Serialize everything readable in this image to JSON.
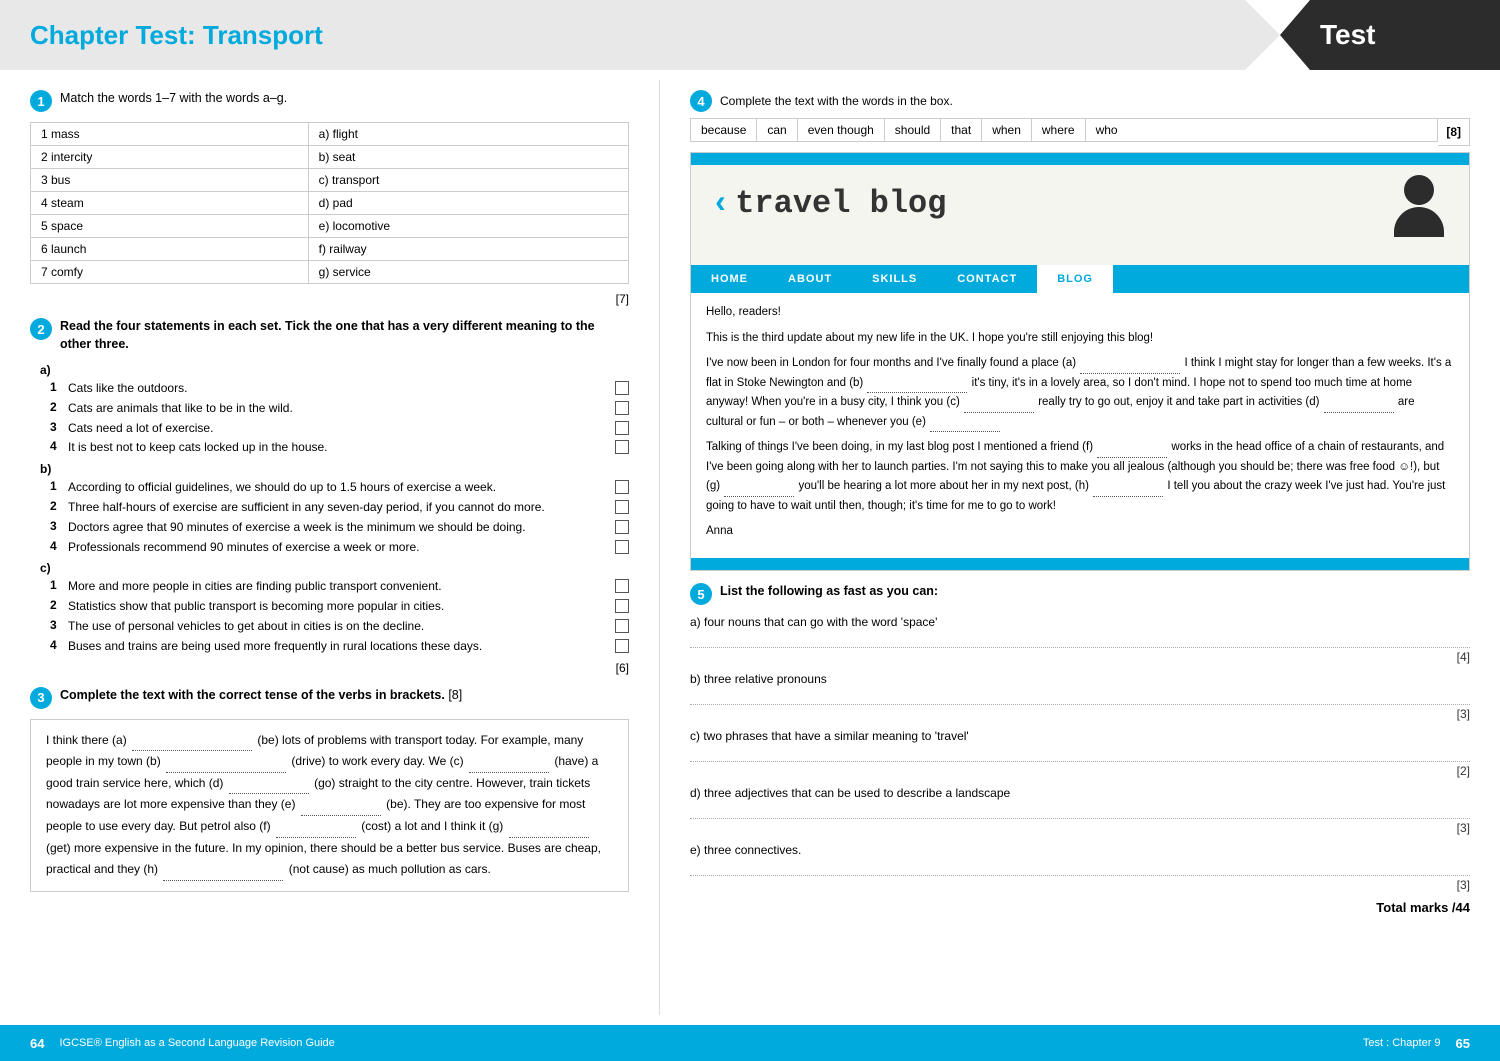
{
  "header": {
    "title": "Chapter Test: Transport",
    "right_label": "Test"
  },
  "q1": {
    "instruction": "Match the words 1–7 with the words a–g.",
    "marks": "[7]",
    "rows": [
      {
        "num": "1",
        "left": "mass",
        "right": "a)  flight"
      },
      {
        "num": "2",
        "left": "intercity",
        "right": "b)  seat"
      },
      {
        "num": "3",
        "left": "bus",
        "right": "c)  transport"
      },
      {
        "num": "4",
        "left": "steam",
        "right": "d)  pad"
      },
      {
        "num": "5",
        "left": "space",
        "right": "e)  locomotive"
      },
      {
        "num": "6",
        "left": "launch",
        "right": "f)  railway"
      },
      {
        "num": "7",
        "left": "comfy",
        "right": "g)  service"
      }
    ]
  },
  "q2": {
    "instruction": "Read the four statements in each set. Tick the one that has a very different meaning to the other three.",
    "groups": [
      {
        "label": "a)",
        "items": [
          "Cats like the outdoors.",
          "Cats are animals that like to be in the wild.",
          "Cats need a lot of exercise.",
          "It is best not to keep cats locked up in the house."
        ]
      },
      {
        "label": "b)",
        "items": [
          "According to official guidelines, we should do up to 1.5 hours of exercise a week.",
          "Three half-hours of exercise are sufficient in any seven-day period, if you cannot do more.",
          "Doctors agree that 90 minutes of exercise a week is the minimum we should be doing.",
          "Professionals recommend 90 minutes of exercise a week or more."
        ]
      },
      {
        "label": "c)",
        "items": [
          "More and more people in cities are finding public transport convenient.",
          "Statistics show that public transport is becoming more popular in cities.",
          "The use of personal vehicles to get about in cities is on the decline.",
          "Buses and trains are being used more frequently in rural locations these days."
        ]
      }
    ],
    "marks": "[6]"
  },
  "q3": {
    "instruction": "Complete the text with the correct tense of the verbs in brackets.",
    "marks": "[8]",
    "text_parts": [
      "I think there (a) ",
      " (be) lots of problems with transport today. For example, many people in my town (b) ",
      " (drive) to work every day. We (c) ",
      " (have) a good train service here, which (d) ",
      " (go) straight to the city centre. However, train tickets nowadays are lot more expensive than they (e) ",
      " (be). They are too expensive for most people to use every day. But petrol also (f) ",
      " (cost) a lot and I think it (g) ",
      " (get) more expensive in the future. In my opinion, there should be a better bus service. Buses are cheap, practical and they (h) ",
      " (not cause) as much pollution as cars."
    ]
  },
  "q4": {
    "instruction": "Complete the text with the words in the box.",
    "marks": "[8]",
    "words": [
      "because",
      "can",
      "even though",
      "should",
      "that",
      "when",
      "where",
      "who"
    ]
  },
  "blog": {
    "title": "travel blog",
    "nav_items": [
      "HOME",
      "ABOUT",
      "SKILLS",
      "CONTACT",
      "BLOG"
    ],
    "active_nav": "BLOG",
    "greeting": "Hello, readers!",
    "intro": "This is the third update about my new life in the UK. I hope you're still enjoying this blog!",
    "para1_parts": [
      "I've now been in London for four months and I've finally found a place (a) ",
      " I think I might stay for longer than a few weeks. It's a flat in Stoke Newington and (b) ",
      " it's tiny, it's in a lovely area, so I don't mind. I hope not to spend too much time at home anyway! When you're in a busy city, I think you (c) ",
      " really try to go out, enjoy it and take part in activities (d) ",
      " are cultural or fun – or both – whenever you (e) ",
      ""
    ],
    "para2_parts": [
      "Talking of things I've been doing, in my last blog post I mentioned a friend (f) ",
      " works in the head office of a chain of restaurants, and I've been going along with her to launch parties. I'm not saying this to make you all jealous (although you should be; there was free food ☺!), but (g) ",
      " you'll be hearing a lot more about her in my next post, (h) ",
      " I tell you about the crazy week I've just had. You're just going to have to wait until then, though; it's time for me to go to work!"
    ],
    "sign": "Anna"
  },
  "q5": {
    "instruction": "List the following as fast as you can:",
    "items": [
      {
        "label": "a)  four nouns that can go with the word 'space'",
        "marks": "[4]"
      },
      {
        "label": "b)  three relative pronouns",
        "marks": "[3]"
      },
      {
        "label": "c)  two phrases that have a similar meaning to 'travel'",
        "marks": "[2]"
      },
      {
        "label": "d)  three adjectives that can be used to describe a landscape",
        "marks": "[3]"
      },
      {
        "label": "e)  three connectives.",
        "marks": "[3]"
      }
    ]
  },
  "footer": {
    "left_page": "64",
    "left_text": "IGCSE® English as a Second Language Revision Guide",
    "right_text": "Test : Chapter 9",
    "right_page": "65"
  },
  "total_marks": "Total marks  /44"
}
